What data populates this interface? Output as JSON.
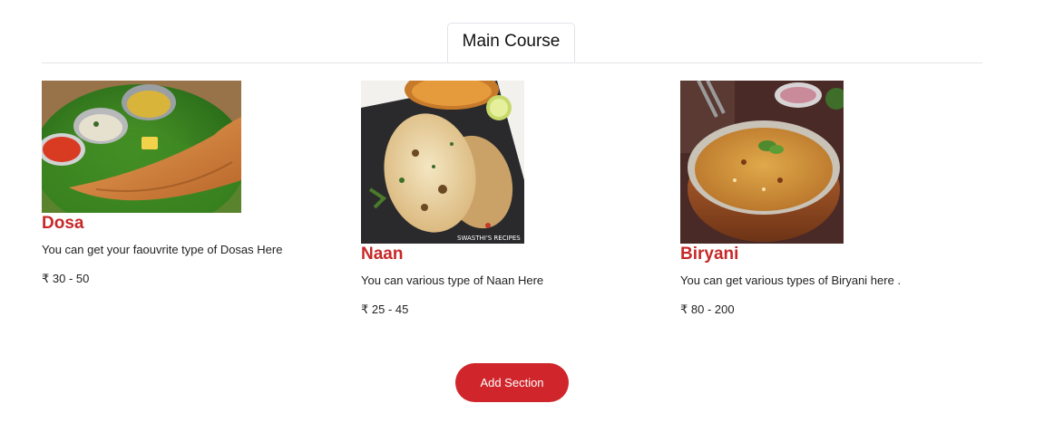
{
  "tabs": [
    {
      "label": "Main Course"
    }
  ],
  "dishes": [
    {
      "name": "Dosa",
      "description": "You can get your faouvrite type of Dosas Here",
      "price": "₹ 30 - 50"
    },
    {
      "name": "Naan",
      "description": "You can various type of Naan Here",
      "price": "₹ 25 - 45",
      "image_caption": "SWASTHI'S RECIPES"
    },
    {
      "name": "Biryani",
      "description": "You can get various types of Biryani here .",
      "price": "₹ 80 - 200"
    }
  ],
  "actions": {
    "add_section_label": "Add Section"
  },
  "colors": {
    "accent": "#d0262b",
    "title_red": "#c62828",
    "divider": "#dfe3e8"
  }
}
